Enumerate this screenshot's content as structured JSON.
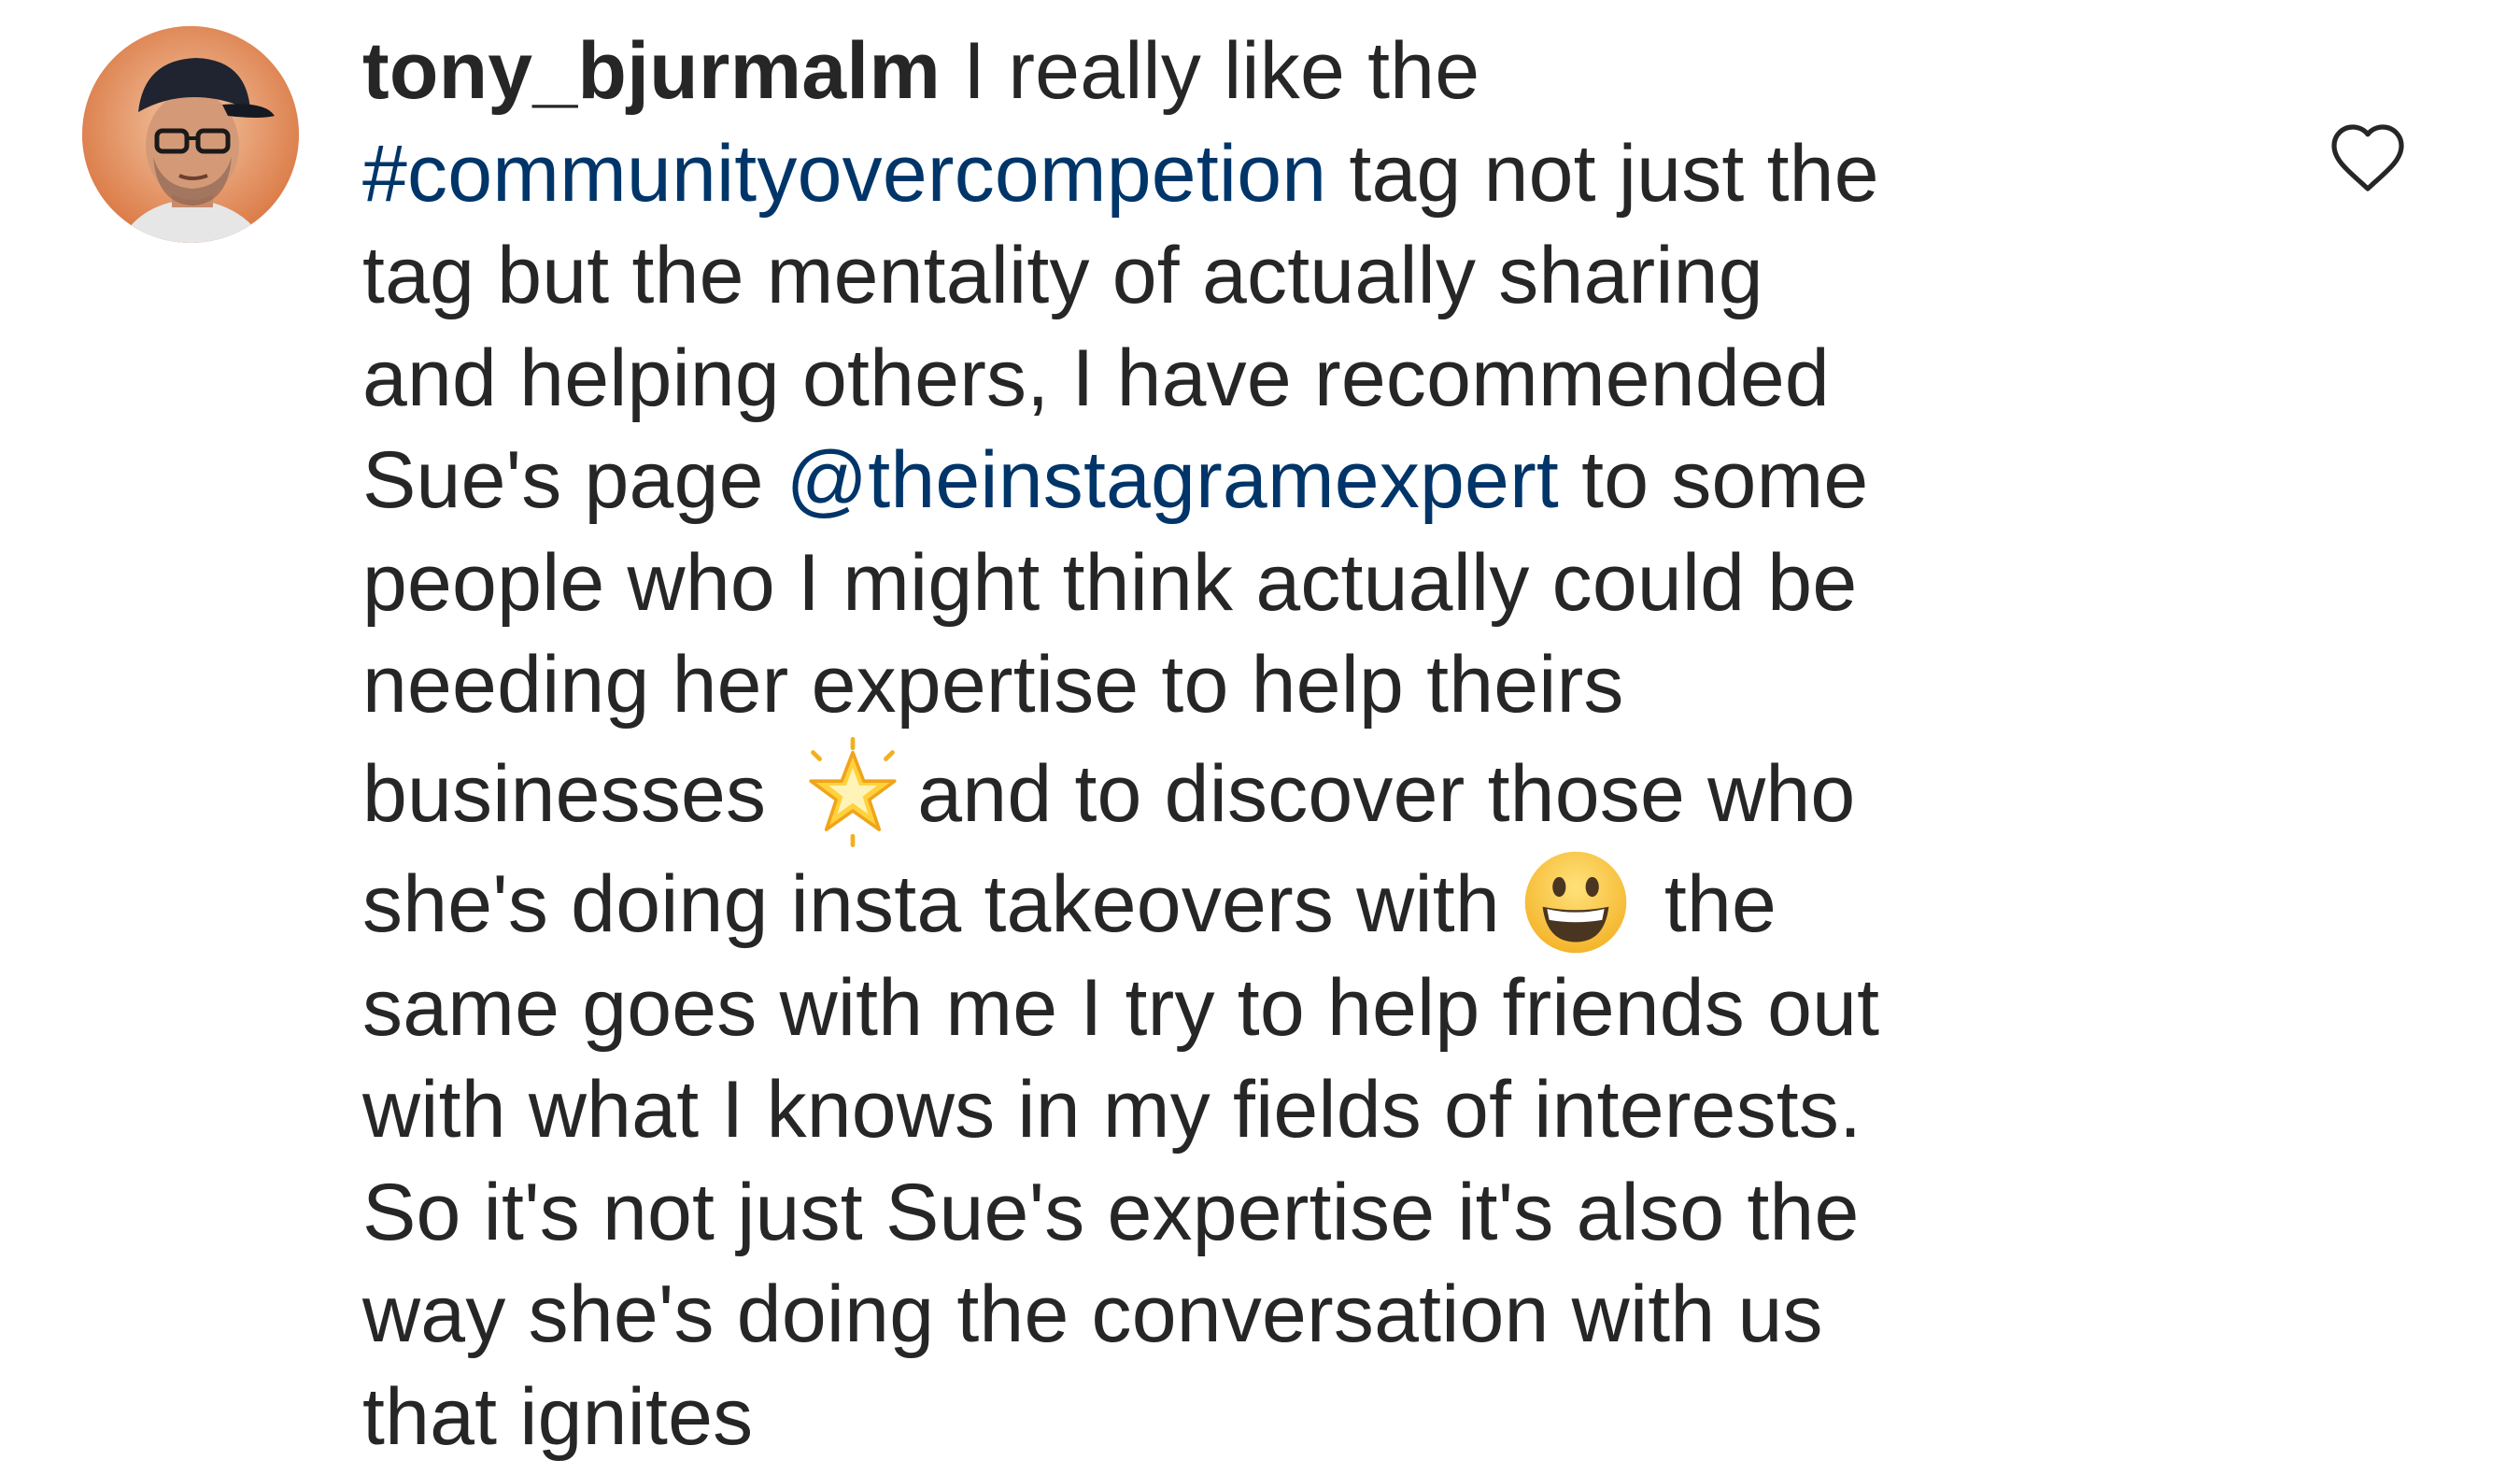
{
  "comment": {
    "username": "tony_bjurmalm",
    "hashtag": "#communityovercompetion",
    "mention": "@theinstagramexpert",
    "lines": [
      "I really like the",
      "tag not just the",
      "tag but the mentality of actually sharing",
      "and helping others, I have recommended",
      "Sue's page",
      "to some",
      "people who I might think actually could be",
      "needing her expertise to help theirs",
      "businesses",
      "and to discover those who",
      "she's doing insta takeovers with",
      "the",
      "same goes with me I try to help friends out",
      "with what I knows in my fields of interests.",
      "So it's not just Sue's expertise it's also the",
      "way she's doing the conversation with us",
      "that ignites"
    ],
    "emojis": [
      "glowing-star-emoji",
      "grinning-face-emoji"
    ]
  },
  "icons": {
    "avatar": "profile-photo",
    "like": "heart-outline-icon"
  },
  "colors": {
    "text": "#262626",
    "link": "#003569",
    "heart": "#262626"
  }
}
